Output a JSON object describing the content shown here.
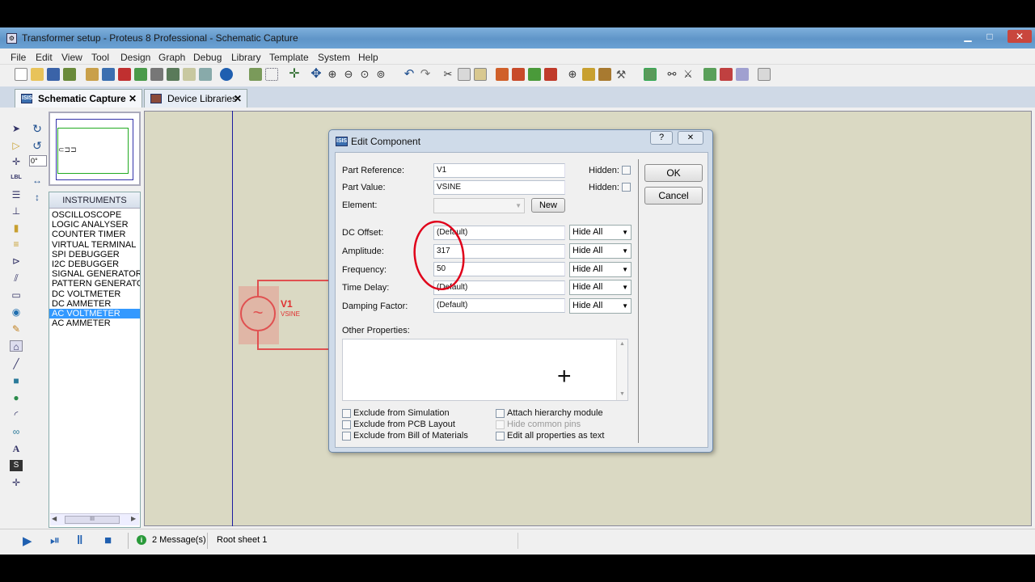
{
  "window": {
    "title": "Transformer setup - Proteus 8 Professional - Schematic Capture",
    "controls": {
      "minimize": "▁",
      "maximize": "□",
      "close": "✕"
    }
  },
  "menu": [
    "File",
    "Edit",
    "View",
    "Tool",
    "Design",
    "Graph",
    "Debug",
    "Library",
    "Template",
    "System",
    "Help"
  ],
  "tabs": [
    {
      "label": "Schematic Capture",
      "icon": "ISIS",
      "close": "✕"
    },
    {
      "label": "Device Libraries",
      "close": "✕"
    }
  ],
  "rotation_field": "0°",
  "devices": {
    "header": "INSTRUMENTS",
    "items": [
      "OSCILLOSCOPE",
      "LOGIC ANALYSER",
      "COUNTER TIMER",
      "VIRTUAL TERMINAL",
      "SPI DEBUGGER",
      "I2C DEBUGGER",
      "SIGNAL GENERATOR",
      "PATTERN GENERATO",
      "DC VOLTMETER",
      "DC AMMETER",
      "AC VOLTMETER",
      "AC AMMETER"
    ],
    "selected_index": 10,
    "scroll_thumb": "III"
  },
  "component": {
    "ref": "V1",
    "value": "VSINE"
  },
  "dialog": {
    "title": "Edit Component",
    "icon": "ISIS",
    "help": "?",
    "close": "✕",
    "part_reference_label": "Part Reference:",
    "part_reference": "V1",
    "part_value_label": "Part Value:",
    "part_value": "VSINE",
    "element_label": "Element:",
    "hidden_label": "Hidden:",
    "new_button": "New",
    "ok_button": "OK",
    "cancel_button": "Cancel",
    "properties": [
      {
        "label": "DC Offset:",
        "value": "(Default)",
        "visibility": "Hide All"
      },
      {
        "label": "Amplitude:",
        "value": "317",
        "visibility": "Hide All"
      },
      {
        "label": "Frequency:",
        "value": "50",
        "visibility": "Hide All"
      },
      {
        "label": "Time Delay:",
        "value": "(Default)",
        "visibility": "Hide All"
      },
      {
        "label": "Damping Factor:",
        "value": "(Default)",
        "visibility": "Hide All"
      }
    ],
    "other_properties_label": "Other Properties:",
    "checkboxes_left": [
      "Exclude from Simulation",
      "Exclude from PCB Layout",
      "Exclude from Bill of Materials"
    ],
    "checkboxes_right": [
      "Attach hierarchy module",
      "Hide common pins",
      "Edit all properties as text"
    ]
  },
  "status": {
    "messages": "2 Message(s)",
    "sheet": "Root sheet 1"
  },
  "colors": {
    "accent": "#3399ff",
    "annotation": "#e0001a",
    "component": "#e05050"
  }
}
